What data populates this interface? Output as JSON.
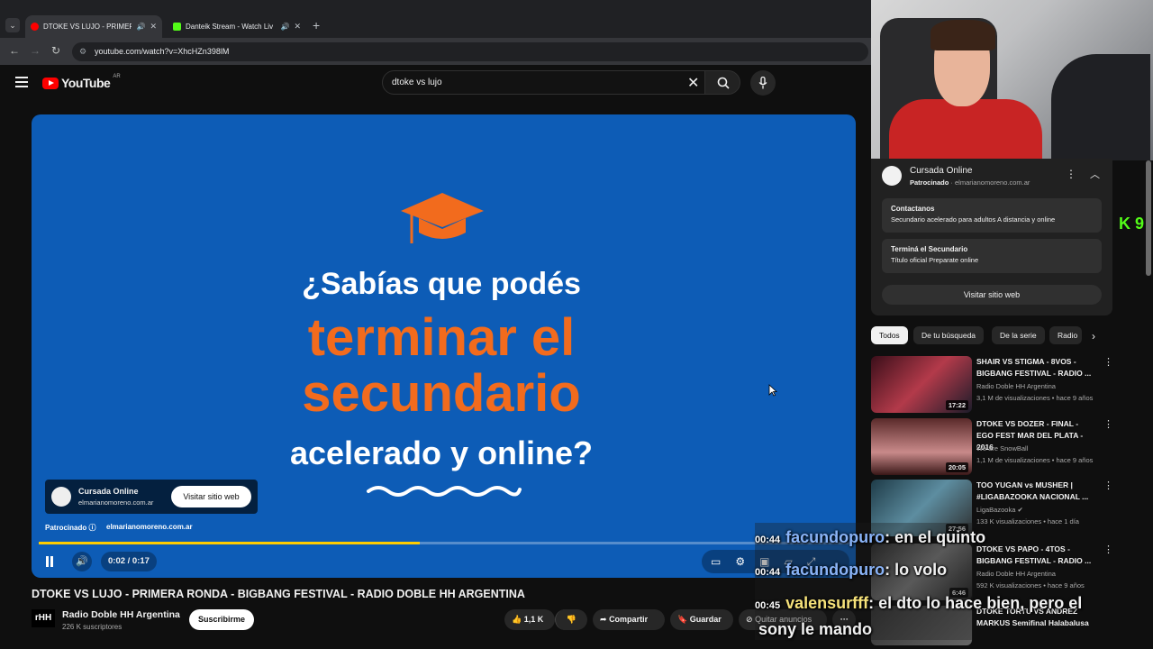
{
  "browser": {
    "tabs": [
      {
        "title": "DTOKE VS LUJO - PRIMERA",
        "favicon_color": "#ff0000",
        "active": true
      },
      {
        "title": "Danteik Stream - Watch Liv",
        "favicon_color": "#53fc18",
        "active": false
      }
    ],
    "url": "youtube.com/watch?v=XhcHZn398lM"
  },
  "header": {
    "logo_text": "YouTube",
    "country_code": "AR",
    "search_value": "dtoke vs lujo"
  },
  "player": {
    "ad_headline_1": "¿Sabías que podés",
    "ad_headline_2": "terminar el",
    "ad_headline_3": "secundario",
    "ad_headline_4": "acelerado y online?",
    "card_name": "Cursada Online",
    "card_url": "elmarianomoreno.com.ar",
    "card_button": "Visitar sitio web",
    "sponsored_label": "Patrocinado",
    "sponsored_url": "elmarianomoreno.com.ar",
    "time": "0:02 / 0:17",
    "progress_percent": 47,
    "progress_color": "#ffcc00",
    "background_color": "#0d5cb6",
    "accent_color": "#f26b1d"
  },
  "video": {
    "title": "DTOKE VS LUJO - PRIMERA RONDA - BIGBANG FESTIVAL - RADIO DOBLE HH ARGENTINA",
    "channel_name": "Radio Doble HH Argentina",
    "channel_avatar": "rHH",
    "subscribers": "226 K suscriptores",
    "subscribe_label": "Suscribirme",
    "likes": "1,1 K",
    "share_label": "Compartir",
    "save_label": "Guardar",
    "remove_ads_label": "Quitar anuncios"
  },
  "ad_panel": {
    "name": "Cursada Online",
    "sponsored": "Patrocinado",
    "url": "elmarianomoreno.com.ar",
    "items": [
      {
        "heading": "Contactanos",
        "desc": "Secundario acelerado para adultos A distancia y online"
      },
      {
        "heading": "Terminá el Secundario",
        "desc": "Título oficial Preparate online"
      }
    ],
    "visit_label": "Visitar sitio web"
  },
  "chips": [
    "Todos",
    "De tu búsqueda",
    "De la serie",
    "Radio"
  ],
  "recommendations": [
    {
      "title": "SHAIR VS STIGMA - 8VOS - BIGBANG FESTIVAL - RADIO ...",
      "channel": "Radio Doble HH Argentina",
      "meta": "3,1 M de visualizaciones • hace 9 años",
      "duration": "17:22"
    },
    {
      "title": "DTOKE VS DOZER - FINAL - EGO FEST MAR DEL PLATA - 2016",
      "channel": "We are SnowBall",
      "meta": "1,1 M de visualizaciones • hace 9 años",
      "duration": "20:05"
    },
    {
      "title": "TOO YUGAN vs MUSHER | #LIGABAZOOKA NACIONAL ...",
      "channel": "LigaBazooka",
      "meta": "133 K visualizaciones • hace 1 día",
      "duration": "27:56"
    },
    {
      "title": "DTOKE VS PAPO - 4TOS - BIGBANG FESTIVAL - RADIO ...",
      "channel": "Radio Doble HH Argentina",
      "meta": "592 K visualizaciones • hace 9 años",
      "duration": "6:46"
    },
    {
      "title": "DTOKE TORTU VS ANDREZ MARKUS Semifinal Halabalusa",
      "channel": "",
      "meta": "",
      "duration": ""
    }
  ],
  "stream_overlay": {
    "kick_text": "K 9",
    "chat": [
      {
        "time": "00:44",
        "user": "facundopuro",
        "msg": ": en el quinto"
      },
      {
        "time": "00:44",
        "user": "facundopuro",
        "msg": ": lo volo"
      },
      {
        "time": "00:45",
        "user": "valensurfff",
        "msg": ": el dto lo hace bien, pero el"
      },
      {
        "time": "",
        "user": "",
        "msg": "sony le mando"
      }
    ]
  }
}
